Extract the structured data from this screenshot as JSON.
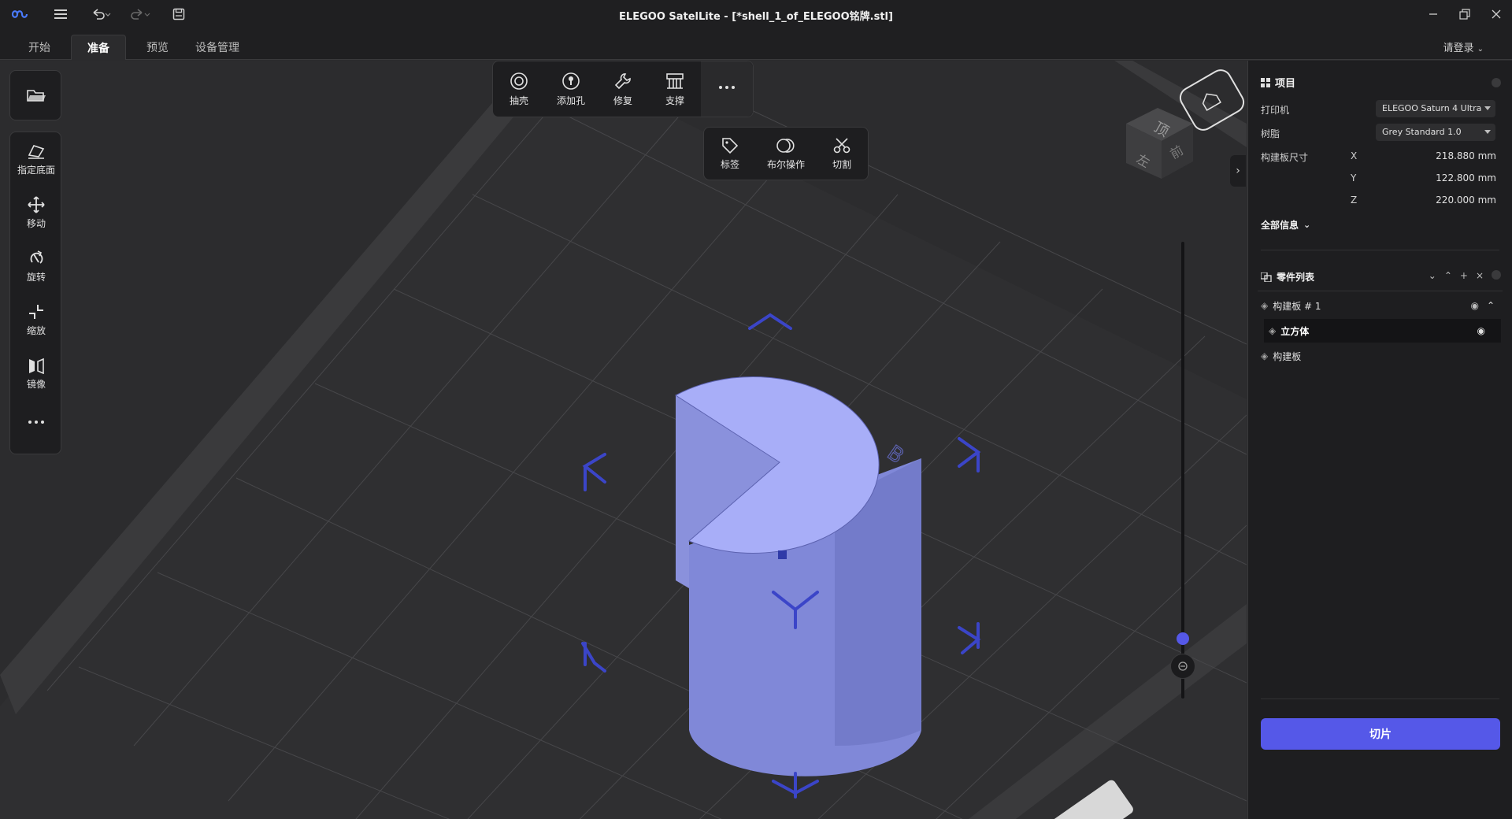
{
  "window": {
    "title": "ELEGOO SatelLite - [*shell_1_of_ELEGOO铭牌.stl]"
  },
  "tabs": [
    {
      "label": "开始",
      "active": false
    },
    {
      "label": "准备",
      "active": true
    },
    {
      "label": "预览",
      "active": false
    },
    {
      "label": "设备管理",
      "active": false
    }
  ],
  "account": {
    "login_label": "请登录"
  },
  "left_toolbar": {
    "items": [
      {
        "label": "指定底面",
        "icon": "place-on-face-icon"
      },
      {
        "label": "移动",
        "icon": "move-icon"
      },
      {
        "label": "旋转",
        "icon": "rotate-icon"
      },
      {
        "label": "缩放",
        "icon": "scale-icon"
      },
      {
        "label": "镜像",
        "icon": "mirror-icon"
      }
    ]
  },
  "top_toolbar": {
    "items": [
      {
        "label": "抽壳",
        "icon": "hollow-icon"
      },
      {
        "label": "添加孔",
        "icon": "add-hole-icon"
      },
      {
        "label": "修复",
        "icon": "wrench-icon"
      },
      {
        "label": "支撑",
        "icon": "support-icon"
      }
    ]
  },
  "more_toolbar": {
    "items": [
      {
        "label": "标签",
        "icon": "tag-icon"
      },
      {
        "label": "布尔操作",
        "icon": "boolean-icon"
      },
      {
        "label": "切割",
        "icon": "scissors-icon"
      }
    ]
  },
  "project_panel": {
    "title": "项目",
    "printer_label": "打印机",
    "printer_value": "ELEGOO Saturn 4 Ultra",
    "resin_label": "树脂",
    "resin_value": "Grey Standard 1.0",
    "build_size_label": "构建板尺寸",
    "build_size": [
      {
        "axis": "X",
        "value": "218.880 mm"
      },
      {
        "axis": "Y",
        "value": "122.800 mm"
      },
      {
        "axis": "Z",
        "value": "220.000 mm"
      }
    ],
    "all_info_label": "全部信息"
  },
  "parts_panel": {
    "title": "零件列表",
    "items": [
      {
        "label": "构建板 # 1",
        "selected": false
      },
      {
        "label": "立方体",
        "selected": true
      },
      {
        "label": "构建板",
        "selected": false
      }
    ]
  },
  "slice_button": {
    "label": "切片"
  },
  "viewcube": {
    "top_face": "顶",
    "left_face": "左",
    "front_face": "前"
  },
  "model": {
    "engraved_text": "B"
  },
  "colors": {
    "accent": "#5558e8",
    "model": "#9aa0f0",
    "gizmo": "#3b45c8",
    "background": "#2c2c2e",
    "panel": "#1e1e20"
  }
}
